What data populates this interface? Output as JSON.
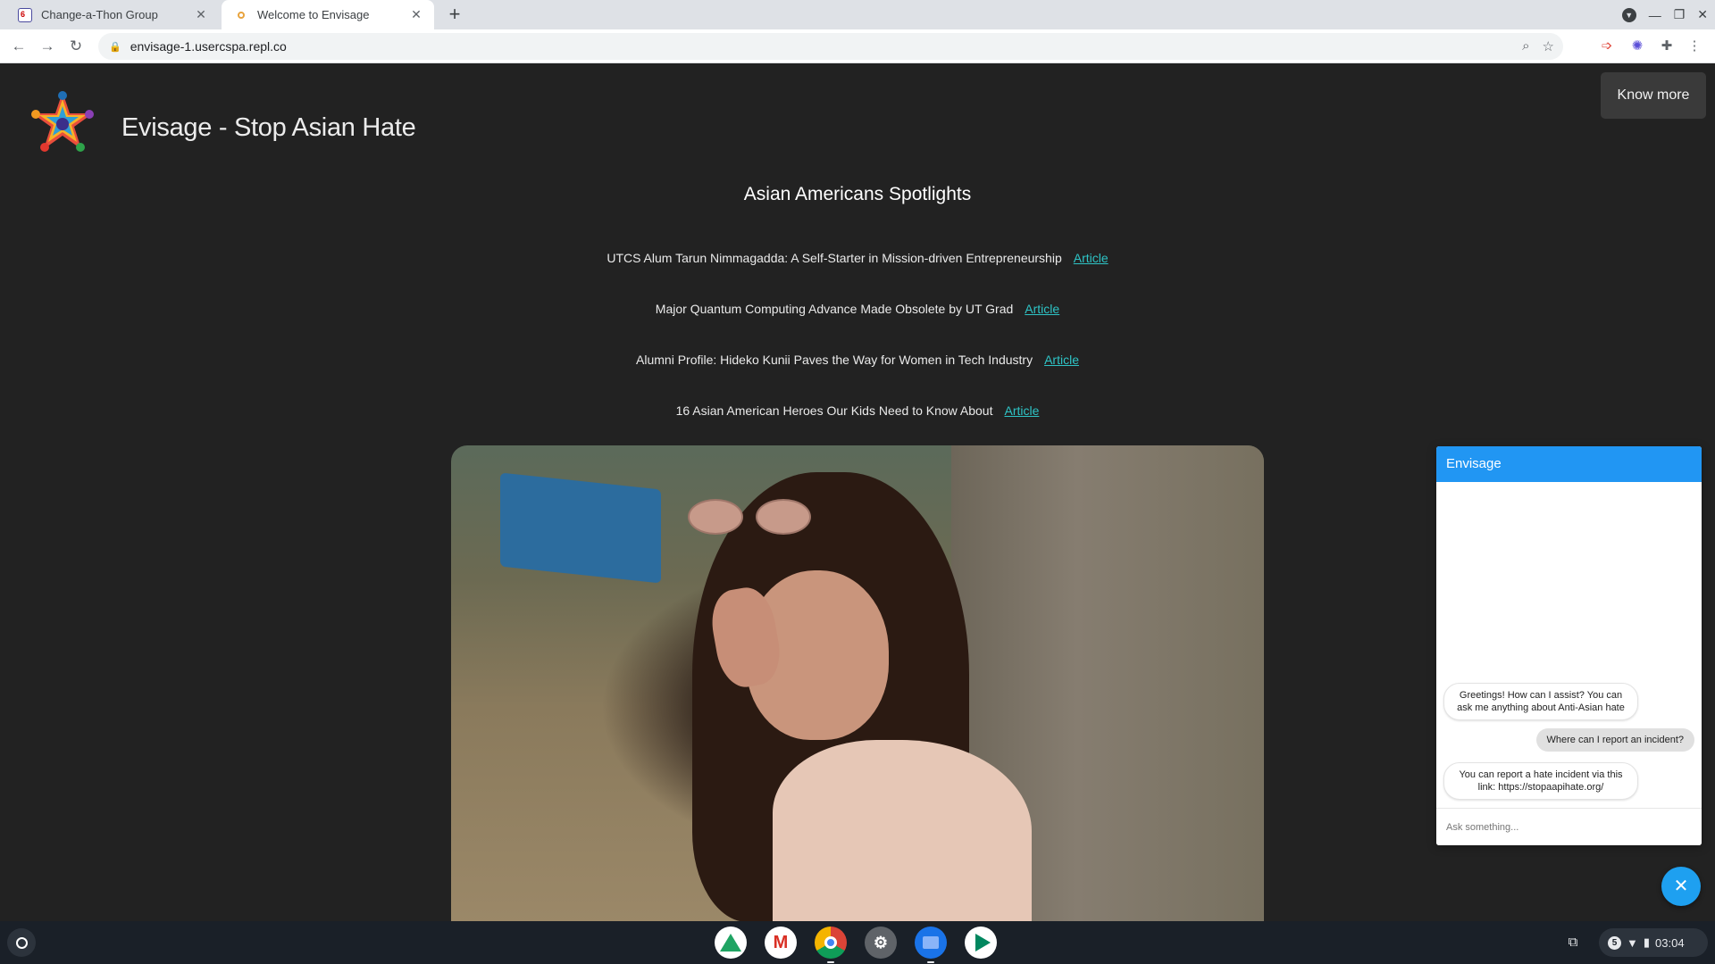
{
  "browser": {
    "tabs": [
      {
        "title": "Change-a-Thon Group",
        "active": false
      },
      {
        "title": "Welcome to Envisage",
        "active": true
      }
    ],
    "url": "envisage-1.usercspa.repl.co"
  },
  "site": {
    "title": "Evisage - Stop Asian Hate",
    "know_more_label": "Know more",
    "section_heading": "Asian Americans Spotlights",
    "spotlights": [
      {
        "text": "UTCS Alum Tarun Nimmagadda: A Self-Starter in Mission-driven Entrepreneurship",
        "link": "Article"
      },
      {
        "text": "Major Quantum Computing Advance Made Obsolete by UT Grad",
        "link": "Article"
      },
      {
        "text": "Alumni Profile: Hideko Kunii Paves the Way for Women in Tech Industry",
        "link": "Article"
      },
      {
        "text": "16 Asian American Heroes Our Kids Need to Know About",
        "link": "Article"
      }
    ]
  },
  "chat": {
    "title": "Envisage",
    "messages": [
      {
        "from": "bot",
        "text": "Greetings! How can I assist? You can ask me anything about Anti-Asian hate"
      },
      {
        "from": "user",
        "text": "Where can I report an incident?"
      },
      {
        "from": "bot",
        "text": "You can report a hate incident via this link: https://stopaapihate.org/"
      }
    ],
    "input_placeholder": "Ask something...",
    "fab_icon": "close-icon"
  },
  "shelf": {
    "apps": [
      "drive",
      "gmail",
      "chrome",
      "settings",
      "files",
      "play-store"
    ],
    "notification_count": "5",
    "time": "03:04"
  },
  "colors": {
    "page_bg": "#222222",
    "link": "#2ec4c6",
    "chat_header": "#2196f3"
  }
}
